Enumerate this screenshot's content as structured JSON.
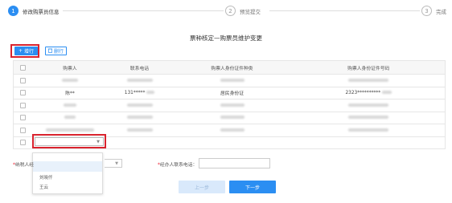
{
  "steps": [
    {
      "number": "1",
      "label": "修改购票员信息",
      "active": true
    },
    {
      "number": "2",
      "label": "预览提交",
      "active": false
    },
    {
      "number": "3",
      "label": "完成",
      "active": false
    }
  ],
  "page_title": "票种核定—购票员维护变更",
  "toolbar": {
    "add_label": "增行",
    "delete_label": "删行"
  },
  "table": {
    "headers": [
      "",
      "购票人",
      "联系电话",
      "购票人身份证件种类",
      "购票人身份证件号码"
    ],
    "rows": [
      {
        "buyer": "",
        "phone": "",
        "id_type": "",
        "id_number": ""
      },
      {
        "buyer": "陈**",
        "phone": "131*****",
        "id_type": "居民身份证",
        "id_number": "2323**********"
      },
      {
        "buyer": "",
        "phone": "",
        "id_type": "",
        "id_number": ""
      },
      {
        "buyer": "",
        "phone": "",
        "id_type": "",
        "id_number": ""
      },
      {
        "buyer": "",
        "phone": "",
        "id_type": "",
        "id_number": ""
      }
    ]
  },
  "row_select": {
    "value": ""
  },
  "dropdown_options": [
    "刘晓仟",
    "王云"
  ],
  "form": {
    "tax_label_req": "*",
    "tax_label": "纳税人经",
    "contact_label_req": "*",
    "contact_label": "经办人联系电话：",
    "contact_value": ""
  },
  "footer": {
    "prev_label": "上一步",
    "next_label": "下一步"
  },
  "colors": {
    "primary": "#2b8ef2",
    "highlight_outline": "#d9232e"
  }
}
